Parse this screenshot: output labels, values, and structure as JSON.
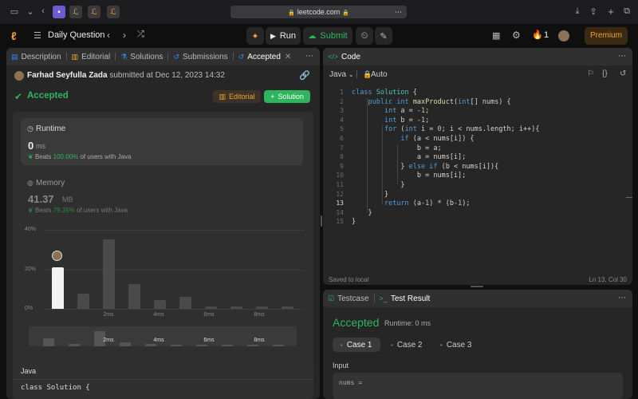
{
  "browser": {
    "url": "leetcode.com"
  },
  "nav": {
    "problem_list": "Daily Question",
    "run": "Run",
    "submit": "Submit",
    "streak": "1",
    "premium": "Premium"
  },
  "left_tabs": {
    "description": "Description",
    "editorial": "Editorial",
    "solutions": "Solutions",
    "submissions": "Submissions",
    "accepted": "Accepted"
  },
  "submission": {
    "author": "Farhad Seyfulla Zada",
    "submitted_text": "submitted at Dec 12, 2023 14:32",
    "status": "Accepted",
    "editorial_btn": "Editorial",
    "solution_btn": "Solution"
  },
  "runtime": {
    "label": "Runtime",
    "value": "0",
    "unit": "ms",
    "beats_prefix": "Beats",
    "beats_pct": "100.00%",
    "beats_suffix": "of users with Java"
  },
  "memory": {
    "label": "Memory",
    "value": "41.37",
    "unit": "MB",
    "beats_prefix": "Beats",
    "beats_pct": "79.35%",
    "beats_suffix": "of users with Java"
  },
  "chart_data": {
    "type": "bar",
    "y_ticks": [
      "40%",
      "20%",
      "0%"
    ],
    "ylim": [
      0,
      40
    ],
    "x_ticks": [
      "2ms",
      "4ms",
      "6ms",
      "8ms"
    ],
    "values": [
      21,
      7.5,
      35,
      12.5,
      4.5,
      6,
      1.4,
      1.4,
      1.4,
      1.4
    ],
    "highlight_index": 0,
    "mini_values": [
      4.5,
      1.5,
      8.5,
      2.5,
      1.5,
      1.0,
      1.0,
      1.0,
      1.0,
      1.0
    ],
    "mini_labels": [
      "2ms",
      "4ms",
      "6ms",
      "8ms"
    ]
  },
  "code_preview": {
    "lang": "Java",
    "first_line": "class Solution {"
  },
  "editor": {
    "title": "Code",
    "lang": "Java",
    "auto": "Auto",
    "saved": "Saved to local",
    "cursor": "Ln 13, Col 30",
    "lines": [
      "class Solution {",
      "    public int maxProduct(int[] nums) {",
      "        int a = -1;",
      "        int b = -1;",
      "        for (int i = 0; i < nums.length; i++){",
      "            if (a < nums[i]) {",
      "                b = a;",
      "                a = nums[i];",
      "            } else if (b < nums[i]){",
      "                b = nums[i];",
      "            }",
      "        }",
      "        return (a-1) * (b-1);",
      "    }",
      "}"
    ],
    "line_numbers": [
      "1",
      "2",
      "3",
      "4",
      "5",
      "6",
      "7",
      "8",
      "9",
      "10",
      "11",
      "12",
      "13",
      "14",
      "15"
    ]
  },
  "result": {
    "testcase_tab": "Testcase",
    "result_tab": "Test Result",
    "status": "Accepted",
    "runtime": "Runtime: 0 ms",
    "cases": [
      "Case 1",
      "Case 2",
      "Case 3"
    ],
    "input_label": "Input",
    "input_var": "nums ="
  }
}
